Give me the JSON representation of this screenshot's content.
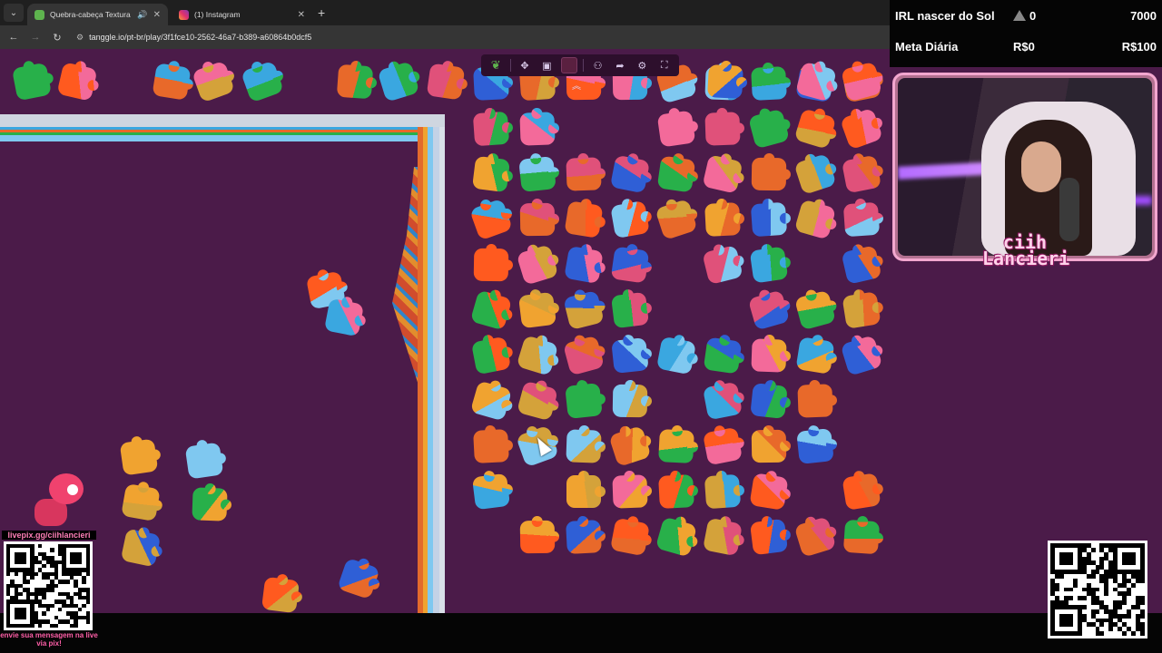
{
  "browser": {
    "tabs": [
      {
        "title": "Quebra-cabeça Textura",
        "active": true
      },
      {
        "title": "(1) Instagram",
        "active": false
      }
    ],
    "url": "tanggle.io/pt-br/play/3f1fce10-2562-46a7-b389-a60864b0dcf5"
  },
  "stream": {
    "stats": [
      {
        "label": "IRL nascer do Sol",
        "mid": "0",
        "value": "7000"
      },
      {
        "label": "Meta Diária",
        "mid": "R$0",
        "value": "R$100"
      }
    ],
    "streamer_name": "ciih Lancieri",
    "livepix_url": "livepix.gg/ciihlancieri",
    "livepix_message": "envie sua mensagem na live via pix!"
  },
  "colors": {
    "board_bg": "#4b1b49",
    "accent_pink": "#f3a7cf",
    "piece_palette": [
      "#e8692a",
      "#3aa7e0",
      "#28b04a",
      "#f0a330",
      "#e0517a",
      "#2f5fd6",
      "#f36a9a",
      "#ff5a1f",
      "#d4a23a",
      "#7fc8f0"
    ]
  },
  "icons": {
    "toolbar": [
      "leaf-icon",
      "puzzle-piece-icon",
      "image-preview-icon",
      "color-swatch-icon",
      "players-icon",
      "share-icon",
      "settings-icon",
      "fullscreen-icon"
    ],
    "collapse": "chevron-up-icon"
  }
}
